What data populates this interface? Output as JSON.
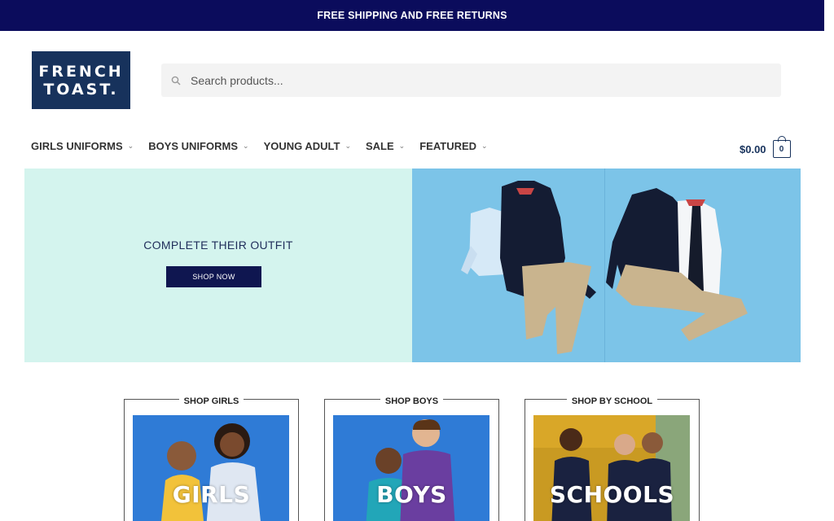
{
  "announcement": {
    "text": "FREE SHIPPING AND FREE RETURNS"
  },
  "logo": {
    "line1": "FRENCH",
    "line2": "TOAST."
  },
  "search": {
    "placeholder": "Search products..."
  },
  "nav": {
    "items": [
      {
        "label": "GIRLS UNIFORMS"
      },
      {
        "label": "BOYS UNIFORMS"
      },
      {
        "label": "YOUNG ADULT"
      },
      {
        "label": "SALE"
      },
      {
        "label": "FEATURED"
      }
    ]
  },
  "cart": {
    "amount": "$0.00",
    "count": "0"
  },
  "hero": {
    "headline": "COMPLETE THEIR OUTFIT",
    "button_label": "SHOP NOW"
  },
  "categories": [
    {
      "title": "SHOP GIRLS",
      "label": "GIRLS"
    },
    {
      "title": "SHOP BOYS",
      "label": "BOYS"
    },
    {
      "title": "SHOP BY SCHOOL",
      "label": "SCHOOLS"
    }
  ],
  "colors": {
    "navy": "#0b0c5c",
    "brand": "#17325c",
    "mint": "#d4f4ee",
    "sky": "#7cc4e8"
  }
}
